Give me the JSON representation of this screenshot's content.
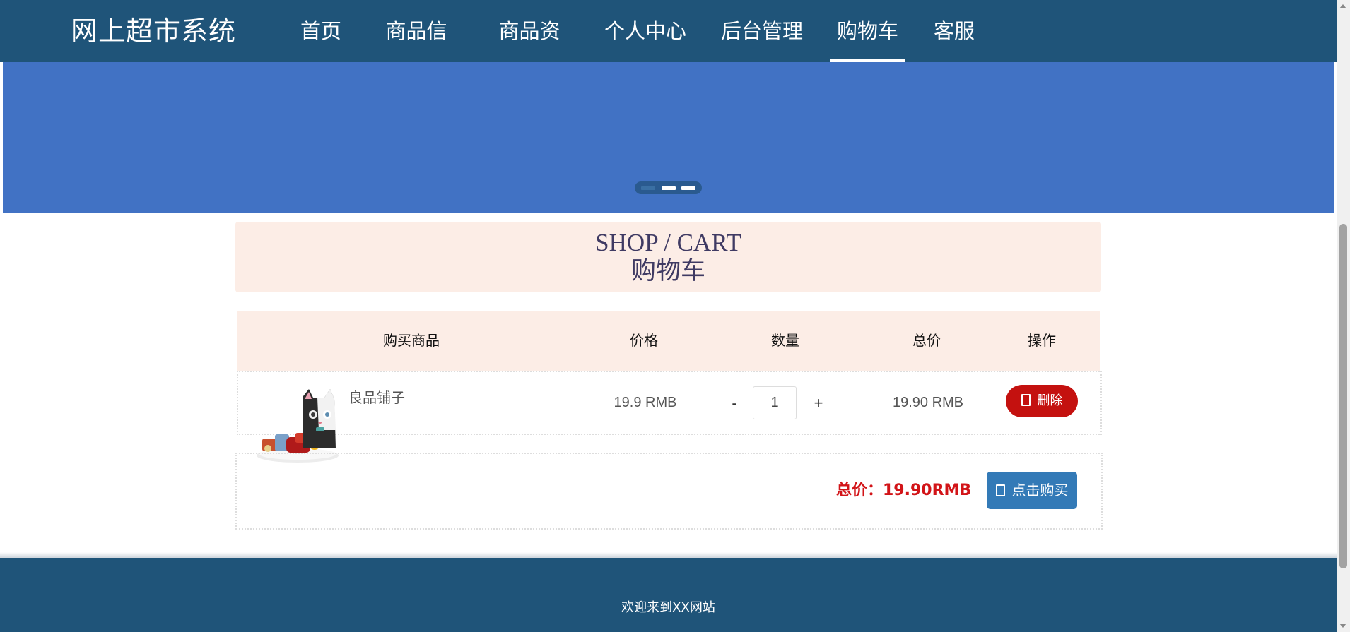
{
  "header": {
    "brand": "网上超市系统",
    "nav": [
      {
        "label": "首页",
        "active": false
      },
      {
        "label": "商品信息",
        "active": false
      },
      {
        "label": "商品资讯",
        "active": false
      },
      {
        "label": "个人中心",
        "active": false
      },
      {
        "label": "后台管理",
        "active": false
      },
      {
        "label": "购物车",
        "active": true
      },
      {
        "label": "客服",
        "active": false
      }
    ]
  },
  "banner": {
    "color": "#4172c4",
    "slide_indicator": {
      "count": 3,
      "active_index": 0
    }
  },
  "cart": {
    "title_en": "SHOP / CART",
    "title_cn": "购物车",
    "columns": [
      "购买商品",
      "价格",
      "数量",
      "总价",
      "操作"
    ],
    "items": [
      {
        "name": "良品铺子",
        "price": "19.9 RMB",
        "quantity": "1",
        "qty_minus": "-",
        "qty_plus": "+",
        "subtotal": "19.90 RMB",
        "delete_label": "删除",
        "delete_icon": "trash-icon"
      }
    ],
    "total_label": "总价：19.90RMB",
    "buy_label": "点击购买",
    "buy_icon": "cart-icon"
  },
  "footer": {
    "text": "欢迎来到XX网站"
  },
  "colors": {
    "header_bg": "#1f5479",
    "banner_bg": "#4172c4",
    "title_bg": "#fcede6",
    "delete_btn": "#c4110f",
    "buy_btn": "#337ab7",
    "total_text": "#d21418"
  }
}
